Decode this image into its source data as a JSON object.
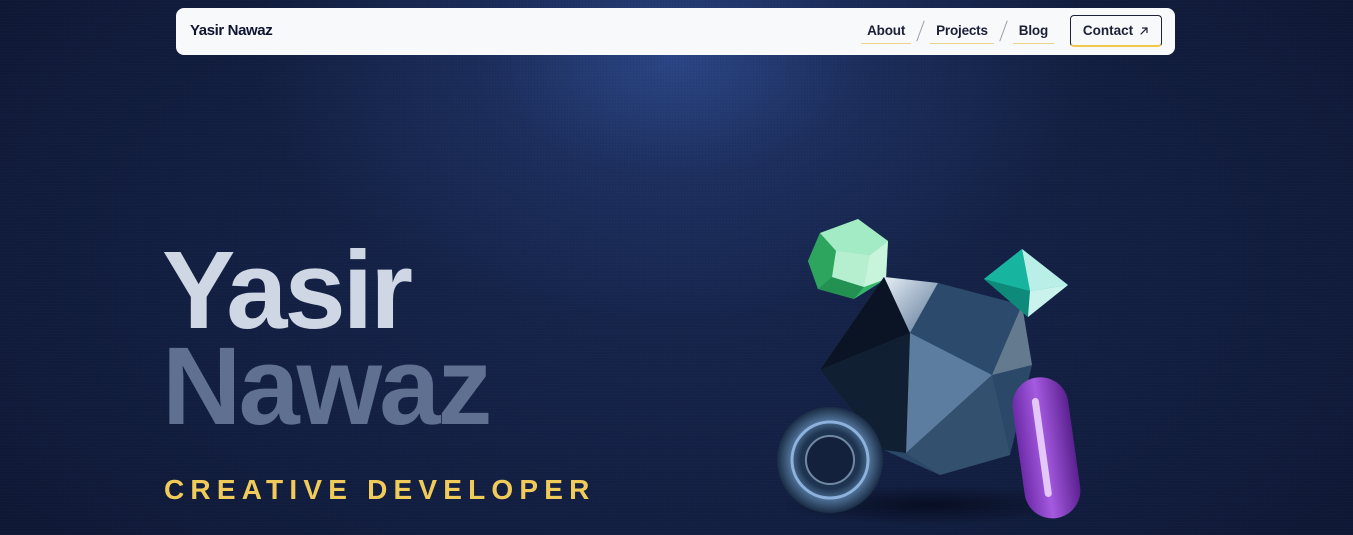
{
  "navbar": {
    "brand": "Yasir Nawaz",
    "links": [
      {
        "label": "About"
      },
      {
        "label": "Projects"
      },
      {
        "label": "Blog"
      }
    ],
    "contact_label": "Contact",
    "contact_icon": "arrow-up-right-icon"
  },
  "hero": {
    "first_name": "Yasir",
    "last_name": "Nawaz",
    "role": "CREATIVE DEVELOPER"
  },
  "art": {
    "shapes": [
      "green-dodecahedron",
      "teal-octahedron",
      "dark-icosahedron",
      "blue-torus",
      "purple-capsule"
    ]
  },
  "colors": {
    "background": "#121e40",
    "glow": "#2c488a",
    "accent_yellow": "#f1cb5a",
    "name_light": "#cfd6e4",
    "name_muted": "#5f7090",
    "nav_bg": "#f8f9fb"
  }
}
